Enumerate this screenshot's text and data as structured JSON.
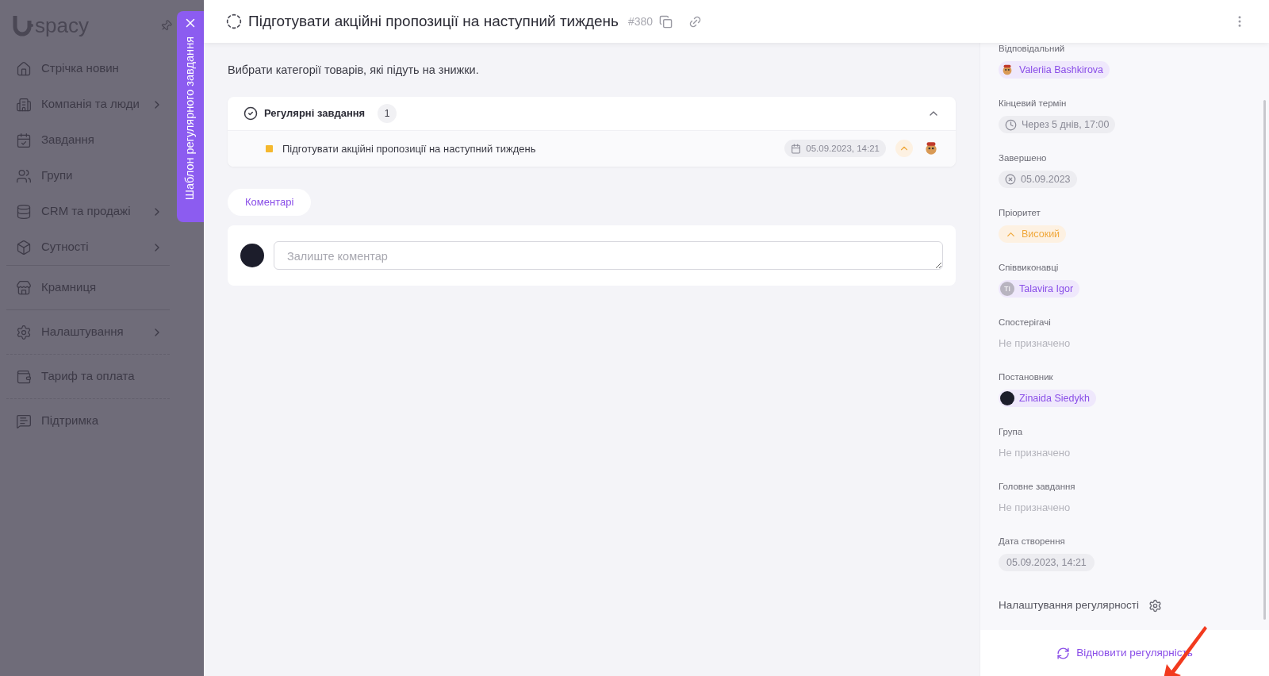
{
  "sidebar": {
    "logo": "spacy",
    "sections": [
      [
        {
          "label": "Стрічка новин",
          "has_submenu": false
        },
        {
          "label": "Компанія та люди",
          "has_submenu": true
        },
        {
          "label": "Завдання",
          "has_submenu": false
        },
        {
          "label": "Групи",
          "has_submenu": false
        },
        {
          "label": "CRM та продажі",
          "has_submenu": true
        },
        {
          "label": "Сутності",
          "has_submenu": true
        }
      ],
      [
        {
          "label": "Крамниця",
          "has_submenu": false
        }
      ],
      [
        {
          "label": "Налаштування",
          "has_submenu": true
        }
      ],
      [
        {
          "label": "Тариф та оплата",
          "has_submenu": false
        }
      ],
      [
        {
          "label": "Підтримка",
          "has_submenu": false
        }
      ]
    ]
  },
  "panel_tab": {
    "label": "Шаблон регулярного завдання"
  },
  "header": {
    "title": "Підготувати акційні пропозиції на наступний тиждень",
    "number": "#380"
  },
  "description": "Вибрати категорії товарів, які підуть на знижки.",
  "subtasks": {
    "title": "Регулярні завдання",
    "count": "1",
    "expanded": true,
    "items": [
      {
        "title": "Підготувати акційні пропозиції на наступний тиждень",
        "color": "#f5b82e",
        "date": "05.09.2023, 14:21"
      }
    ]
  },
  "tabs": [
    {
      "label": "Коментарі",
      "selected": true
    }
  ],
  "comment": {
    "placeholder": "Залиште коментар"
  },
  "fields": [
    {
      "label": "Відповідальний",
      "kind": "person",
      "value": "Valeriia Bashkirova",
      "avatar": {
        "kind": "mascot"
      }
    },
    {
      "label": "Кінцевий термін",
      "kind": "deadline",
      "value": "Через 5 днів, 17:00"
    },
    {
      "label": "Завершено",
      "kind": "completed",
      "value": "05.09.2023"
    },
    {
      "label": "Пріоритет",
      "kind": "priority",
      "value": "Високий"
    },
    {
      "label": "Співвиконавці",
      "kind": "person",
      "value": "Talavira Igor",
      "avatar": {
        "kind": "initials",
        "initials": "TI"
      }
    },
    {
      "label": "Спостерігачі",
      "kind": "empty",
      "value": "Не призначено"
    },
    {
      "label": "Постановник",
      "kind": "person",
      "value": "Zinaida Siedykh",
      "avatar": {
        "kind": "dark"
      }
    },
    {
      "label": "Група",
      "kind": "empty",
      "value": "Не призначено"
    },
    {
      "label": "Головне завдання",
      "kind": "empty",
      "value": "Не призначено"
    },
    {
      "label": "Дата створення",
      "kind": "date",
      "value": "05.09.2023, 14:21"
    }
  ],
  "recurrence_settings": {
    "label": "Налаштування регулярності"
  },
  "restore_button": {
    "label": "Відновити регулярність"
  }
}
